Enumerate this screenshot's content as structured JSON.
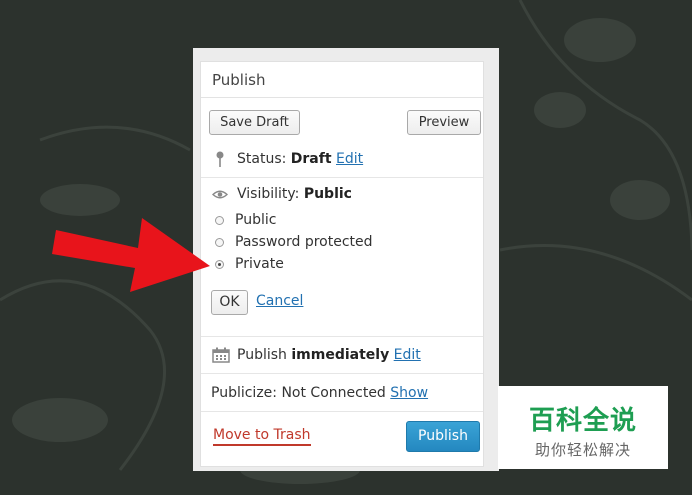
{
  "box": {
    "title": "Publish",
    "save_draft": "Save Draft",
    "preview": "Preview",
    "status_label": "Status:",
    "status_value": "Draft",
    "status_edit": "Edit",
    "visibility_label": "Visibility:",
    "visibility_value": "Public",
    "options": [
      {
        "label": "Public",
        "selected": false
      },
      {
        "label": "Password protected",
        "selected": false
      },
      {
        "label": "Private",
        "selected": true
      }
    ],
    "ok": "OK",
    "cancel": "Cancel",
    "publish_label": "Publish",
    "publish_value": "immediately",
    "publish_edit": "Edit",
    "publicize_label": "Publicize: Not Connected",
    "publicize_show": "Show",
    "trash": "Move to Trash",
    "publish_button": "Publish"
  },
  "watermark": {
    "title": "百科全说",
    "subtitle": "助你轻松解决"
  },
  "colors": {
    "arrow": "#e8141b",
    "publish_button": "#2a8fc7",
    "watermark_green": "#1e9e52"
  }
}
